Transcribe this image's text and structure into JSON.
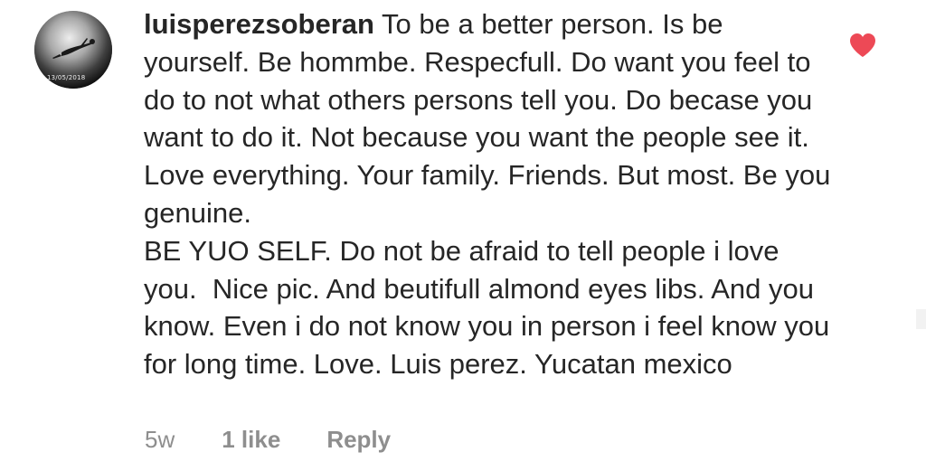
{
  "comment": {
    "avatar_date": "13/05/2018",
    "username": "luisperezsoberan",
    "text": "To be a better person. Is be yourself. Be hommbe. Respecfull. Do want you feel to do to not what others persons tell you. Do becase you want to do it. Not because you want the people see it. Love everything. Your family. Friends. But most. Be you genuine.\nBE YUO SELF. Do not be afraid to tell people i love you.  Nice pic. And beutifull almond eyes libs. And you know. Even i do not know you in person i feel know you for long time. Love. Luis perez. Yucatan mexico",
    "age": "5w",
    "likes": "1 like",
    "reply_label": "Reply",
    "liked": true,
    "heart_color": "#ed4956"
  }
}
